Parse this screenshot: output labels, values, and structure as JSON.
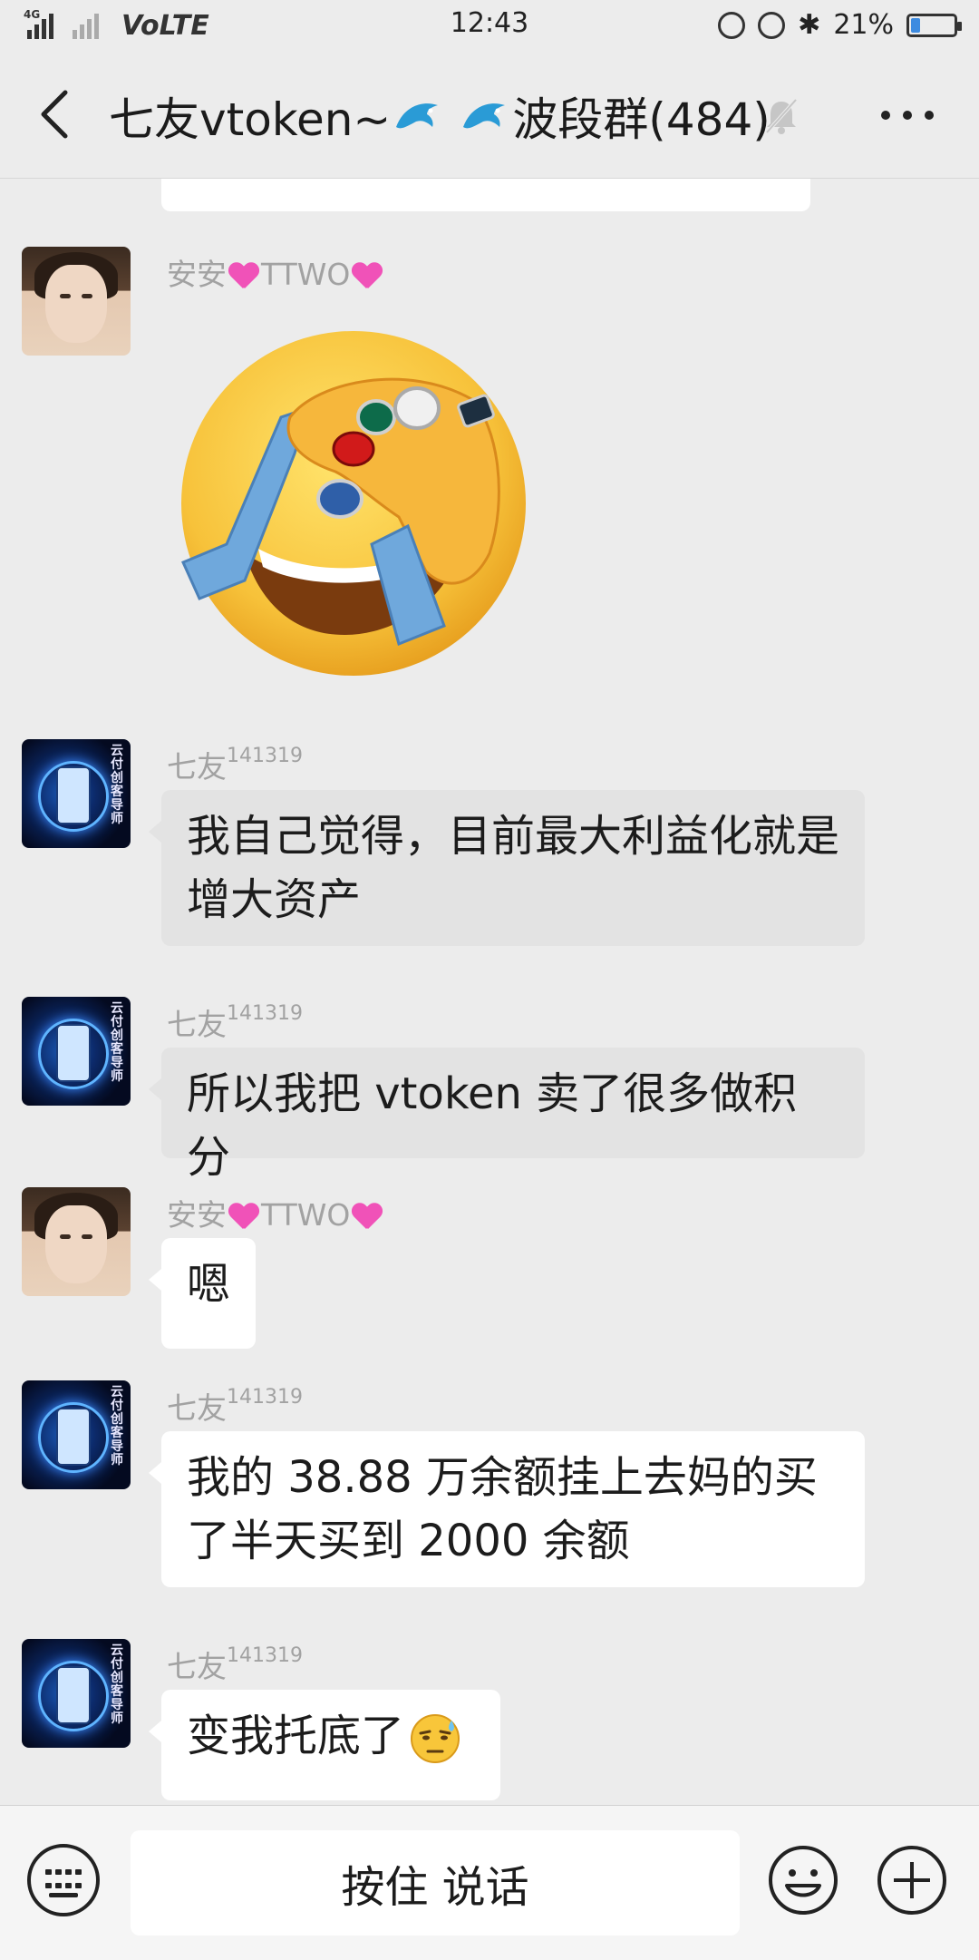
{
  "status_bar": {
    "network_tag": "4G",
    "volte": "VoLTE",
    "time": "12:43",
    "battery_text": "21%",
    "battery_level": 0.21
  },
  "header": {
    "title_prefix": "七友vtoken~",
    "title_suffix": "波段群(484)"
  },
  "messages": [
    {
      "sender_name": "安安",
      "sender_suffix": "TTWO",
      "type": "sticker"
    },
    {
      "sender_name": "七友",
      "sender_suffix": "141319",
      "text": "我自己觉得，目前最大利益化就是增大资产"
    },
    {
      "sender_name": "七友",
      "sender_suffix": "141319",
      "text": "所以我把 vtoken 卖了很多做积分"
    },
    {
      "sender_name": "安安",
      "sender_suffix": "TTWO",
      "text": "嗯"
    },
    {
      "sender_name": "七友",
      "sender_suffix": "141319",
      "text": "我的 38.88 万余额挂上去妈的买了半天买到 2000 余额"
    },
    {
      "sender_name": "七友",
      "sender_suffix": "141319",
      "text": "变我托底了"
    }
  ],
  "input_bar": {
    "hold_to_talk": "按住 说话"
  },
  "icons": {
    "back": "chevron-left-icon",
    "mute": "bell-off-icon",
    "more": "more-dots-icon",
    "keyboard": "keyboard-icon",
    "emoji": "smiley-icon",
    "plus": "plus-icon"
  }
}
